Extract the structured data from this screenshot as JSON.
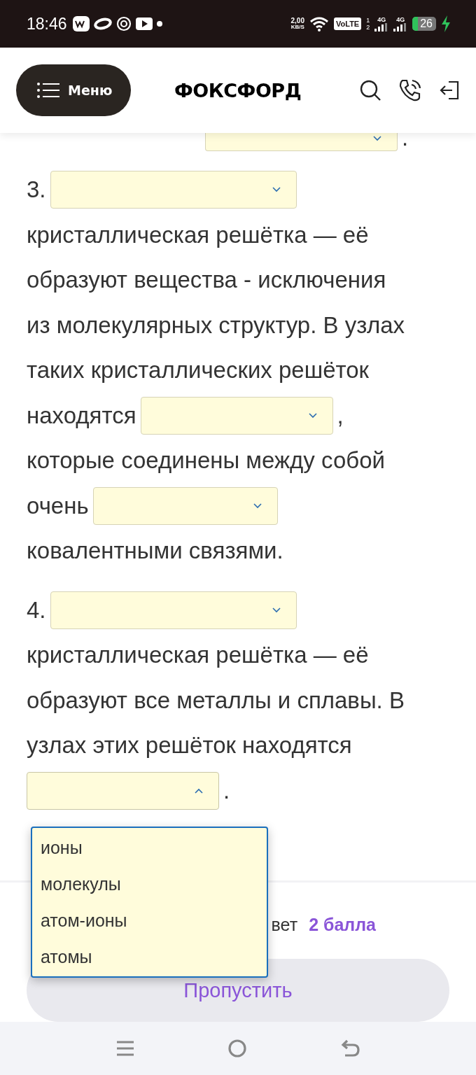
{
  "status_bar": {
    "time": "18:46",
    "speed": "2,00",
    "speed_unit": "KB/S",
    "volte": "VoLTE",
    "sims": [
      "1",
      "2"
    ],
    "networks": [
      "4G",
      "4G"
    ],
    "battery": "26"
  },
  "header": {
    "menu_label": "Меню",
    "logo": "ФОКСФОРД"
  },
  "blocks": [
    {
      "lines": [
        [
          {
            "kind": "select_cut",
            "expanded": false
          },
          {
            "kind": "text",
            "text": "."
          }
        ]
      ]
    },
    {
      "lines": [
        [
          {
            "kind": "text",
            "text": "3."
          },
          {
            "kind": "select",
            "expanded": false
          }
        ],
        [
          {
            "kind": "text",
            "text": "кристаллическая решётка — её"
          }
        ],
        [
          {
            "kind": "text",
            "text": "образуют вещества - исключения"
          }
        ],
        [
          {
            "kind": "text",
            "text": "из молекулярных структур. В узлах"
          }
        ],
        [
          {
            "kind": "text",
            "text": "таких кристаллических решёток"
          }
        ],
        [
          {
            "kind": "text",
            "text": "находятся"
          },
          {
            "kind": "select",
            "expanded": false
          },
          {
            "kind": "text",
            "text": ","
          }
        ],
        [
          {
            "kind": "text",
            "text": "которые соединены между собой"
          }
        ],
        [
          {
            "kind": "text",
            "text": "очень"
          },
          {
            "kind": "select",
            "expanded": false
          }
        ],
        [
          {
            "kind": "text",
            "text": "ковалентными связями."
          }
        ]
      ]
    },
    {
      "lines": [
        [
          {
            "kind": "text",
            "text": "4."
          },
          {
            "kind": "select",
            "expanded": false
          }
        ],
        [
          {
            "kind": "text",
            "text": "кристаллическая решётка — её"
          }
        ],
        [
          {
            "kind": "text",
            "text": "образуют все металлы и сплавы. В"
          }
        ],
        [
          {
            "kind": "text",
            "text": "узлах этих решёток находятся"
          }
        ],
        [
          {
            "kind": "select",
            "expanded": true,
            "options": [
              "ионы",
              "молекулы",
              "атом-ионы",
              "атомы"
            ]
          },
          {
            "kind": "text",
            "text": "."
          }
        ]
      ]
    }
  ],
  "score": {
    "label": "вет",
    "points": "2 балла"
  },
  "skip_button": "Пропустить"
}
